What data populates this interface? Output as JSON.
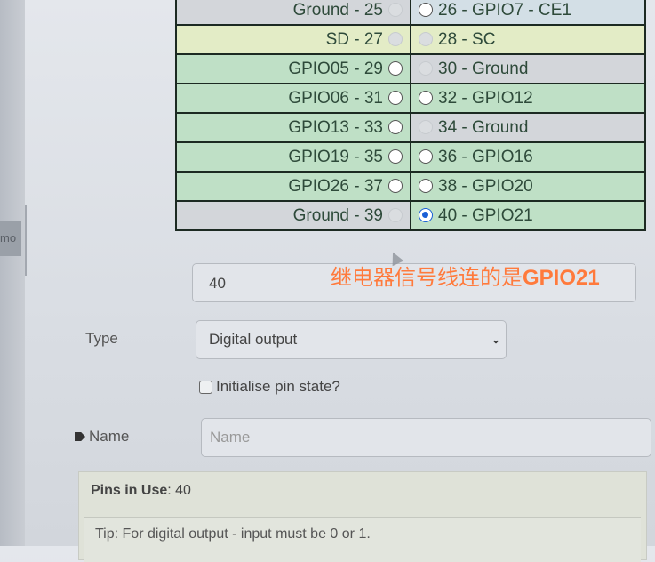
{
  "pin_table": {
    "rows": [
      {
        "left": {
          "label": "Ground - 25",
          "state": "disabled",
          "color": "ground"
        },
        "right": {
          "label": "26 - GPIO7 - CE1",
          "state": "unchecked",
          "color": "blue"
        }
      },
      {
        "left": {
          "label": "SD - 27",
          "state": "disabled",
          "color": "yellow"
        },
        "right": {
          "label": "28 - SC",
          "state": "disabled",
          "color": "yellow"
        }
      },
      {
        "left": {
          "label": "GPIO05 - 29",
          "state": "unchecked",
          "color": "green"
        },
        "right": {
          "label": "30 - Ground",
          "state": "disabled",
          "color": "ground"
        }
      },
      {
        "left": {
          "label": "GPIO06 - 31",
          "state": "unchecked",
          "color": "green"
        },
        "right": {
          "label": "32 - GPIO12",
          "state": "unchecked",
          "color": "green"
        }
      },
      {
        "left": {
          "label": "GPIO13 - 33",
          "state": "unchecked",
          "color": "green"
        },
        "right": {
          "label": "34 - Ground",
          "state": "disabled",
          "color": "ground"
        }
      },
      {
        "left": {
          "label": "GPIO19 - 35",
          "state": "unchecked",
          "color": "green"
        },
        "right": {
          "label": "36 - GPIO16",
          "state": "unchecked",
          "color": "green"
        }
      },
      {
        "left": {
          "label": "GPIO26 - 37",
          "state": "unchecked",
          "color": "green"
        },
        "right": {
          "label": "38 - GPIO20",
          "state": "unchecked",
          "color": "green"
        }
      },
      {
        "left": {
          "label": "Ground - 39",
          "state": "disabled",
          "color": "ground"
        },
        "right": {
          "label": "40 - GPIO21",
          "state": "checked",
          "color": "green"
        }
      }
    ],
    "colors": {
      "ground": "#d3d6da",
      "blue": "#d3dfe6",
      "yellow": "#e3ecc6",
      "green": "#bfe0c6",
      "selected": "#1a5fd6"
    }
  },
  "pin_input": {
    "value": "40"
  },
  "overlay_caption": {
    "text_cn": "继电器信号线连的是",
    "text_bold": "GPIO21",
    "color": "#ff7a3c"
  },
  "left_tab": {
    "text": "mo"
  },
  "type_field": {
    "label": "Type",
    "selected": "Digital output",
    "chevron": "chevron-down-icon"
  },
  "init_checkbox": {
    "label": "Initialise pin state?",
    "checked": false
  },
  "name_field": {
    "label": "Name",
    "placeholder": "Name",
    "value": "",
    "icon": "tag-icon"
  },
  "info": {
    "pins_in_use_label": "Pins in Use",
    "pins_in_use_value": ": 40",
    "tip": "Tip: For digital output - input must be 0 or 1."
  }
}
